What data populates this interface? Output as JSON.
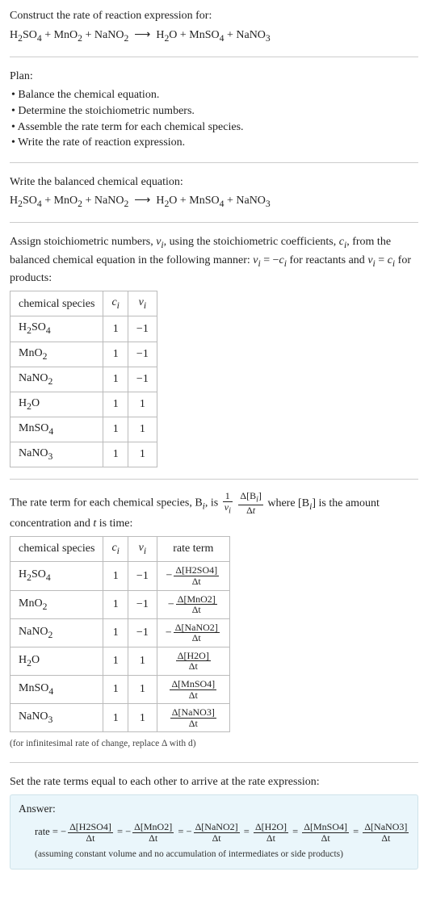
{
  "intro": {
    "title": "Construct the rate of reaction expression for:",
    "equation_html": "H<sub>2</sub>SO<sub>4</sub> + MnO<sub>2</sub> + NaNO<sub>2</sub> &nbsp;⟶&nbsp; H<sub>2</sub>O + MnSO<sub>4</sub> + NaNO<sub>3</sub>"
  },
  "plan": {
    "header": "Plan:",
    "items": [
      "Balance the chemical equation.",
      "Determine the stoichiometric numbers.",
      "Assemble the rate term for each chemical species.",
      "Write the rate of reaction expression."
    ]
  },
  "balanced": {
    "header": "Write the balanced chemical equation:",
    "equation_html": "H<sub>2</sub>SO<sub>4</sub> + MnO<sub>2</sub> + NaNO<sub>2</sub> &nbsp;⟶&nbsp; H<sub>2</sub>O + MnSO<sub>4</sub> + NaNO<sub>3</sub>"
  },
  "stoich": {
    "intro_html": "Assign stoichiometric numbers, <span class='italic'>ν<sub>i</sub></span>, using the stoichiometric coefficients, <span class='italic'>c<sub>i</sub></span>, from the balanced chemical equation in the following manner: <span class='italic'>ν<sub>i</sub></span> = −<span class='italic'>c<sub>i</sub></span> for reactants and <span class='italic'>ν<sub>i</sub></span> = <span class='italic'>c<sub>i</sub></span> for products:",
    "headers": [
      "chemical species",
      "c_i",
      "v_i"
    ],
    "header_html": {
      "c_i": "<span class='italic'>c<sub>i</sub></span>",
      "v_i": "<span class='italic'>ν<sub>i</sub></span>"
    },
    "rows": [
      {
        "species_html": "H<sub>2</sub>SO<sub>4</sub>",
        "c": "1",
        "v": "−1"
      },
      {
        "species_html": "MnO<sub>2</sub>",
        "c": "1",
        "v": "−1"
      },
      {
        "species_html": "NaNO<sub>2</sub>",
        "c": "1",
        "v": "−1"
      },
      {
        "species_html": "H<sub>2</sub>O",
        "c": "1",
        "v": "1"
      },
      {
        "species_html": "MnSO<sub>4</sub>",
        "c": "1",
        "v": "1"
      },
      {
        "species_html": "NaNO<sub>3</sub>",
        "c": "1",
        "v": "1"
      }
    ]
  },
  "rate_terms": {
    "intro_pre": "The rate term for each chemical species, B",
    "intro_mid": ", is ",
    "intro_post_html": " where [B<sub><span class='italic'>i</span></sub>] is the amount concentration and <span class='italic'>t</span> is time:",
    "big_frac": {
      "num1": "1",
      "den1_html": "<span class='italic'>ν<sub>i</sub></span>",
      "num2_html": "Δ[B<sub><span class='italic'>i</span></sub>]",
      "den2_html": "Δ<span class='italic'>t</span>"
    },
    "headers": [
      "chemical species",
      "c_i",
      "v_i",
      "rate term"
    ],
    "rows": [
      {
        "species_html": "H<sub>2</sub>SO<sub>4</sub>",
        "c": "1",
        "v": "−1",
        "rate_num": "Δ[H2SO4]",
        "rate_den": "Δt",
        "neg": true
      },
      {
        "species_html": "MnO<sub>2</sub>",
        "c": "1",
        "v": "−1",
        "rate_num": "Δ[MnO2]",
        "rate_den": "Δt",
        "neg": true
      },
      {
        "species_html": "NaNO<sub>2</sub>",
        "c": "1",
        "v": "−1",
        "rate_num": "Δ[NaNO2]",
        "rate_den": "Δt",
        "neg": true
      },
      {
        "species_html": "H<sub>2</sub>O",
        "c": "1",
        "v": "1",
        "rate_num": "Δ[H2O]",
        "rate_den": "Δt",
        "neg": false
      },
      {
        "species_html": "MnSO<sub>4</sub>",
        "c": "1",
        "v": "1",
        "rate_num": "Δ[MnSO4]",
        "rate_den": "Δt",
        "neg": false
      },
      {
        "species_html": "NaNO<sub>3</sub>",
        "c": "1",
        "v": "1",
        "rate_num": "Δ[NaNO3]",
        "rate_den": "Δt",
        "neg": false
      }
    ],
    "note": "(for infinitesimal rate of change, replace Δ with d)"
  },
  "final": {
    "header": "Set the rate terms equal to each other to arrive at the rate expression:",
    "answer_label": "Answer:",
    "rate_prefix": "rate = ",
    "terms": [
      {
        "neg": true,
        "num": "Δ[H2SO4]",
        "den": "Δt"
      },
      {
        "neg": true,
        "num": "Δ[MnO2]",
        "den": "Δt"
      },
      {
        "neg": true,
        "num": "Δ[NaNO2]",
        "den": "Δt"
      },
      {
        "neg": false,
        "num": "Δ[H2O]",
        "den": "Δt"
      },
      {
        "neg": false,
        "num": "Δ[MnSO4]",
        "den": "Δt"
      },
      {
        "neg": false,
        "num": "Δ[NaNO3]",
        "den": "Δt"
      }
    ],
    "assume": "(assuming constant volume and no accumulation of intermediates or side products)"
  }
}
